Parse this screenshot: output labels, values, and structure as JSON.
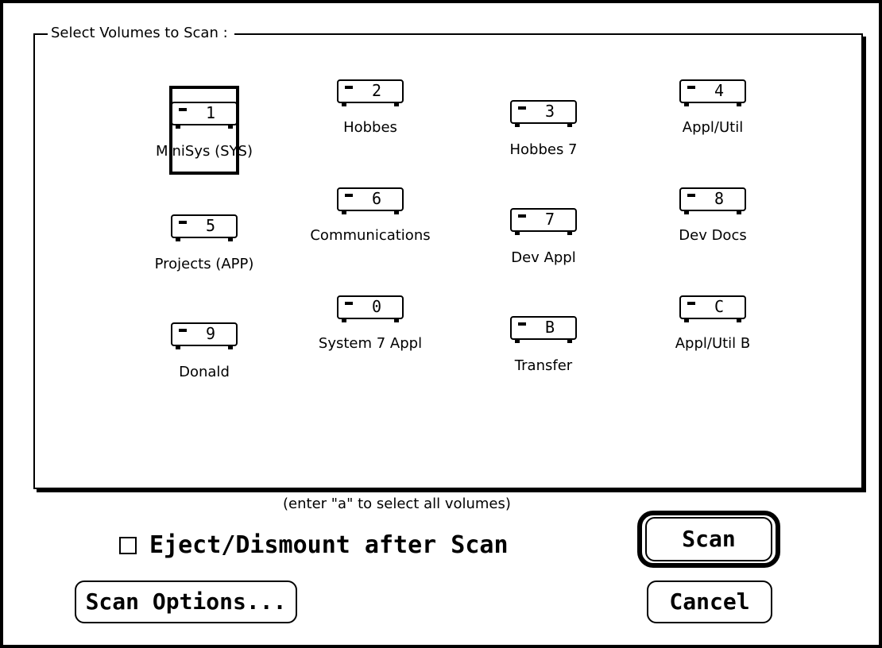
{
  "dialog": {
    "group_title": "Select Volumes to Scan :",
    "volumes": [
      {
        "key": "1",
        "name": "MiniSys (SYS)",
        "selected": true,
        "icon": "hard-disk-icon"
      },
      {
        "key": "2",
        "name": "Hobbes",
        "selected": false,
        "icon": "hard-disk-icon"
      },
      {
        "key": "3",
        "name": "Hobbes 7",
        "selected": false,
        "icon": "hard-disk-icon"
      },
      {
        "key": "4",
        "name": "Appl/Util",
        "selected": false,
        "icon": "hard-disk-icon"
      },
      {
        "key": "5",
        "name": "Projects (APP)",
        "selected": false,
        "icon": "hard-disk-icon"
      },
      {
        "key": "6",
        "name": "Communications",
        "selected": false,
        "icon": "hard-disk-icon"
      },
      {
        "key": "7",
        "name": "Dev Appl",
        "selected": false,
        "icon": "hard-disk-icon"
      },
      {
        "key": "8",
        "name": "Dev Docs",
        "selected": false,
        "icon": "hard-disk-icon"
      },
      {
        "key": "9",
        "name": "Donald",
        "selected": false,
        "icon": "hard-disk-icon"
      },
      {
        "key": "0",
        "name": "System 7 Appl",
        "selected": false,
        "icon": "hard-disk-icon"
      },
      {
        "key": "B",
        "name": "Transfer",
        "selected": false,
        "icon": "hard-disk-icon"
      },
      {
        "key": "C",
        "name": "Appl/Util B",
        "selected": false,
        "icon": "hard-disk-icon"
      }
    ],
    "hint": "(enter \"a\" to select all volumes)",
    "eject_checkbox": {
      "label": "Eject/Dismount after Scan",
      "checked": false
    },
    "buttons": {
      "scan": "Scan",
      "cancel": "Cancel",
      "scan_options": "Scan Options..."
    }
  }
}
